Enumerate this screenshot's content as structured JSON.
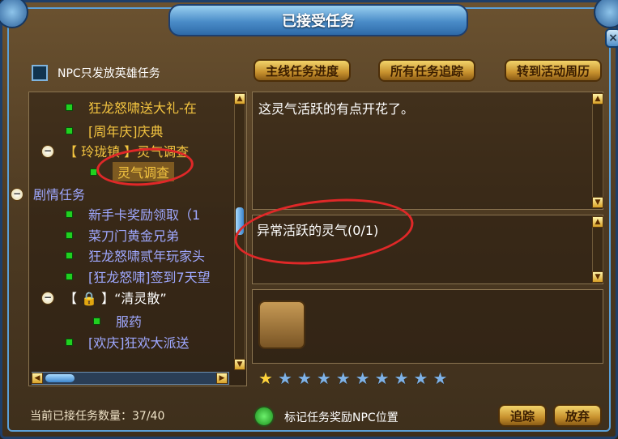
{
  "window": {
    "title": "已接受任务",
    "close_label": "×"
  },
  "filter": {
    "label": "NPC只发放英雄任务",
    "checked": false
  },
  "buttons": {
    "main_progress": "主线任务进度",
    "track_all": "所有任务追踪",
    "activity_calendar": "转到活动周历",
    "track": "追踪",
    "abandon": "放弃"
  },
  "tree": [
    {
      "type": "task",
      "label": "狂龙怒啸送大礼-在",
      "color": "#f4c540"
    },
    {
      "type": "task",
      "label": "[周年庆]庆典",
      "color": "#f4c540"
    },
    {
      "type": "group",
      "label": "【 玲珑镇 】灵气调查",
      "color": "#f4c540"
    },
    {
      "type": "task",
      "label": "灵气调查",
      "color": "#f4c540",
      "selected": true
    },
    {
      "type": "group",
      "label": "剧情任务",
      "color": "#9fa8ff"
    },
    {
      "type": "task",
      "label": "新手卡奖励领取（1",
      "color": "#9fa8ff"
    },
    {
      "type": "task",
      "label": "菜刀门黄金兄弟",
      "color": "#9fa8ff"
    },
    {
      "type": "task",
      "label": "狂龙怒啸贰年玩家头",
      "color": "#9fa8ff"
    },
    {
      "type": "task",
      "label": "[狂龙怒啸]签到7天望",
      "color": "#9fa8ff"
    },
    {
      "type": "group",
      "label": "【 🔒 】“清灵散”",
      "color": "#ffffff"
    },
    {
      "type": "task",
      "label": "服药",
      "color": "#9fa8ff"
    },
    {
      "type": "task",
      "label": "[欢庆]狂欢大派送",
      "color": "#9fa8ff"
    }
  ],
  "description": {
    "text": "这灵气活跃的有点开花了。"
  },
  "objective": {
    "text": "异常活跃的灵气(0/1)"
  },
  "difficulty": {
    "stars_filled": 1,
    "stars_total": 10
  },
  "footer": {
    "task_count": "当前已接任务数量：37/40",
    "mark_npc_label": "标记任务奖励NPC位置"
  },
  "colors": {
    "accent_gold": "#f4c540",
    "story_blue": "#9fa8ff",
    "highlight_red": "#e02828"
  }
}
